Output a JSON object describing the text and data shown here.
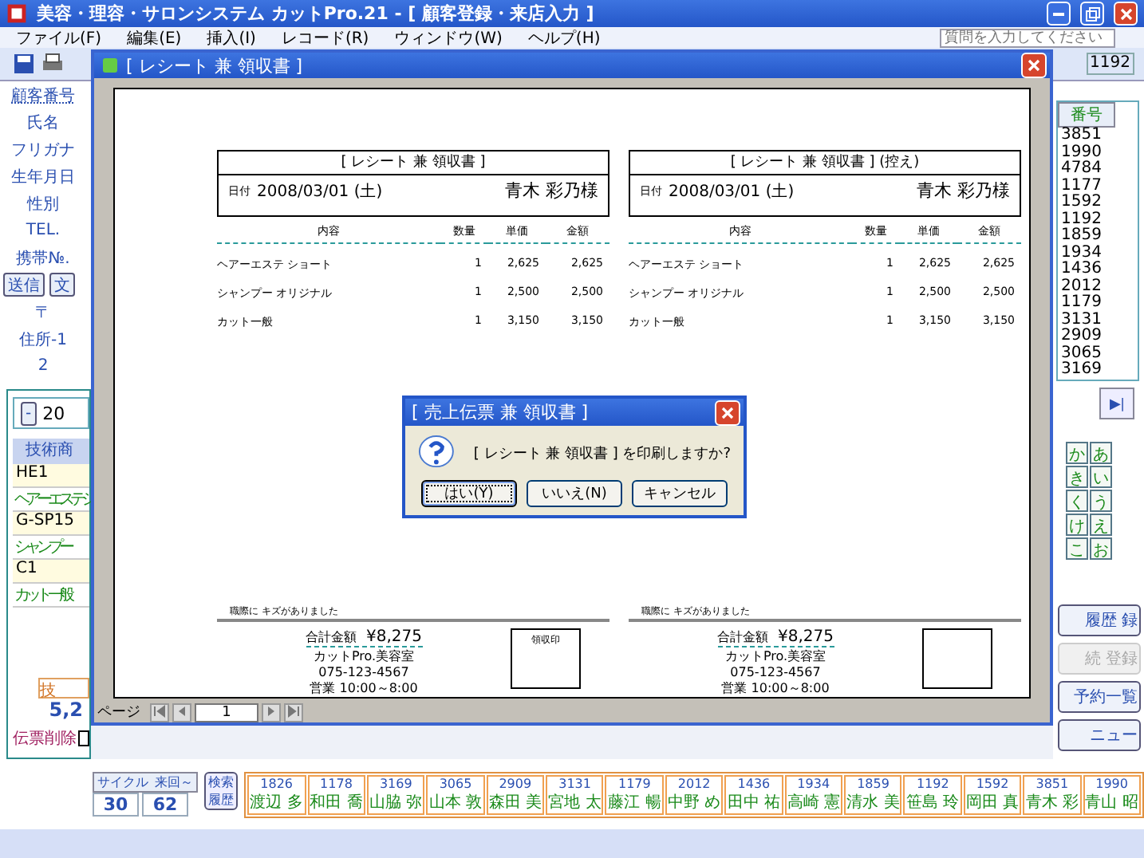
{
  "window": {
    "title": "美容・理容・サロンシステム カットPro.21 - [ 顧客登録・来店入力 ]"
  },
  "menu": [
    "ファイル(F)",
    "編集(E)",
    "挿入(I)",
    "レコード(R)",
    "ウィンドウ(W)",
    "ヘルプ(H)"
  ],
  "help_search": {
    "placeholder": "質問を入力してください"
  },
  "customer_form": {
    "fields": [
      "顧客番号",
      "氏名",
      "フリガナ",
      "生年月日",
      "性別",
      "TEL.",
      "携帯№.",
      "〒",
      "住所-1",
      "2"
    ],
    "send_buttons": [
      "送信",
      "文"
    ]
  },
  "sales": {
    "collapse": "-",
    "date": "20",
    "header": "技術商",
    "items": [
      {
        "code": "HE1",
        "name": "ヘアーエステ シ"
      },
      {
        "code": "G-SP15",
        "name": "シャンプー"
      },
      {
        "code": "C1",
        "name": "カット 一般"
      }
    ],
    "total_label": "技",
    "total": "5,2",
    "delete_label": "伝票削除",
    "delete_checked": false
  },
  "counts": {
    "cycle_label": "サイクル",
    "visits_label": "来回～",
    "cycle": "30",
    "visits": "62",
    "history_button": "検索履歴"
  },
  "recent_customers": [
    {
      "number": "1826",
      "name": "渡辺 多"
    },
    {
      "number": "1178",
      "name": "和田 喬"
    },
    {
      "number": "3169",
      "name": "山脇 弥"
    },
    {
      "number": "3065",
      "name": "山本 敦"
    },
    {
      "number": "2909",
      "name": "森田 美"
    },
    {
      "number": "3131",
      "name": "宮地 太"
    },
    {
      "number": "1179",
      "name": "藤江 暢"
    },
    {
      "number": "2012",
      "name": "中野 め"
    },
    {
      "number": "1436",
      "name": "田中 祐"
    },
    {
      "number": "1934",
      "name": "高崎 憲"
    },
    {
      "number": "1859",
      "name": "清水 美"
    },
    {
      "number": "1192",
      "name": "笹島 玲"
    },
    {
      "number": "1592",
      "name": "岡田 真"
    },
    {
      "number": "3851",
      "name": "青木 彩"
    },
    {
      "number": "1990",
      "name": "青山 昭"
    }
  ],
  "id_list": {
    "header": "番号",
    "ids": [
      "3851",
      "1990",
      "4784",
      "1177",
      "1592",
      "1192",
      "1859",
      "1934",
      "1436",
      "2012",
      "1179",
      "3131",
      "2909",
      "3065",
      "3169"
    ],
    "toolbar_values": [
      "1192"
    ]
  },
  "last_button": "▶|",
  "kana_buttons": [
    [
      "か",
      "あ"
    ],
    [
      "き",
      "い"
    ],
    [
      "く",
      "う"
    ],
    [
      "け",
      "え"
    ],
    [
      "こ",
      "お"
    ]
  ],
  "side_buttons": [
    {
      "label": "履歴 録",
      "disabled": false
    },
    {
      "label": "続 登録",
      "disabled": true
    },
    {
      "label": "予約一覧",
      "disabled": false
    },
    {
      "label": "ニュー",
      "disabled": false
    }
  ],
  "preview": {
    "title": "[ レシート 兼 領収書 ]",
    "page_label": "ページ",
    "page": "1",
    "receipts": [
      {
        "title": "[ レシート 兼 領収書 ]",
        "date_label": "日付",
        "date": "2008/03/01 (土)",
        "customer": "青木 彩乃様",
        "columns": [
          "内容",
          "数量",
          "単価",
          "金額"
        ],
        "rows": [
          [
            "ヘアーエステ ショート",
            "1",
            "2,625",
            "2,625"
          ],
          [
            "シャンプー オリジナル",
            "1",
            "2,500",
            "2,500"
          ],
          [
            "カット一般",
            "1",
            "3,150",
            "3,150"
          ]
        ],
        "note": "職際に キズがありました",
        "total_label": "合計金額",
        "total": "¥8,275",
        "shop": "カットPro.美容室",
        "phone": "075-123-4567",
        "hours": "営業 10:00～8:00",
        "stamp": "領収印"
      },
      {
        "title": "[ レシート 兼 領収書 ] (控え)",
        "date_label": "日付",
        "date": "2008/03/01 (土)",
        "customer": "青木 彩乃様",
        "columns": [
          "内容",
          "数量",
          "単価",
          "金額"
        ],
        "rows": [
          [
            "ヘアーエステ ショート",
            "1",
            "2,625",
            "2,625"
          ],
          [
            "シャンプー オリジナル",
            "1",
            "2,500",
            "2,500"
          ],
          [
            "カット一般",
            "1",
            "3,150",
            "3,150"
          ]
        ],
        "note": "職際に キズがありました",
        "total_label": "合計金額",
        "total": "¥8,275",
        "shop": "カットPro.美容室",
        "phone": "075-123-4567",
        "hours": "営業 10:00～8:00"
      }
    ]
  },
  "dialog": {
    "title": "[ 売上伝票 兼 領収書 ]",
    "message": "[ レシート 兼 領収書 ] を印刷しますか?",
    "buttons": [
      {
        "label": "はい(Y)",
        "selected": true
      },
      {
        "label": "いいえ(N)",
        "selected": false
      },
      {
        "label": "キャンセル",
        "selected": false
      }
    ]
  }
}
